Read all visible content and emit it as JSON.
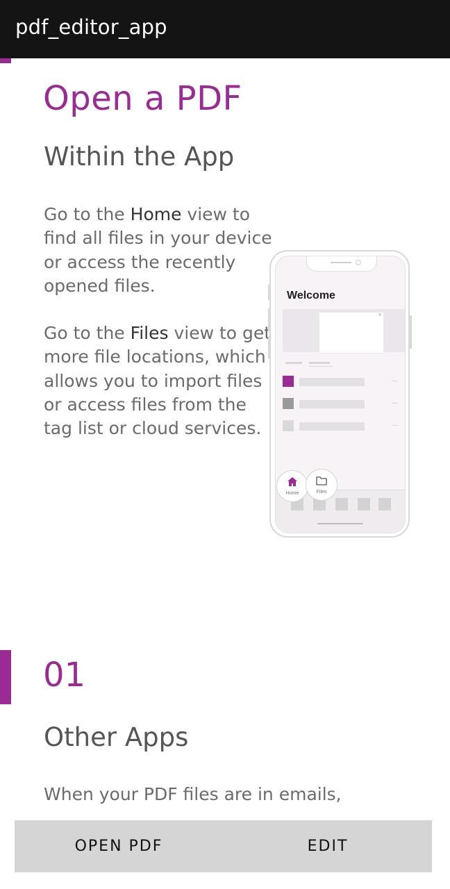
{
  "appbar": {
    "title": "pdf_editor_app"
  },
  "section1": {
    "title": "Open a PDF",
    "subtitle": "Within the App",
    "para1": {
      "pre": "Go to the ",
      "bold": "Home",
      "post": " view to find all files in your device or access the recently opened files."
    },
    "para2": {
      "pre": "Go to the ",
      "bold": "Files",
      "post": " view to get more file locations, which allows you to import files or access files from the tag list or cloud services."
    }
  },
  "illustration": {
    "welcome": "Welcome",
    "home_label": "Home",
    "files_label": "Files",
    "row_menu": "...",
    "accent_color": "#9c2a94"
  },
  "section2": {
    "number": "01",
    "title": "Other Apps",
    "para": "When your PDF files are in emails,"
  },
  "buttons": {
    "open_label": "OPEN PDF",
    "edit_label": "EDIT"
  },
  "colors": {
    "accent": "#9c2a94",
    "appbar": "#141414",
    "button_bar": "#d5d5d5"
  }
}
